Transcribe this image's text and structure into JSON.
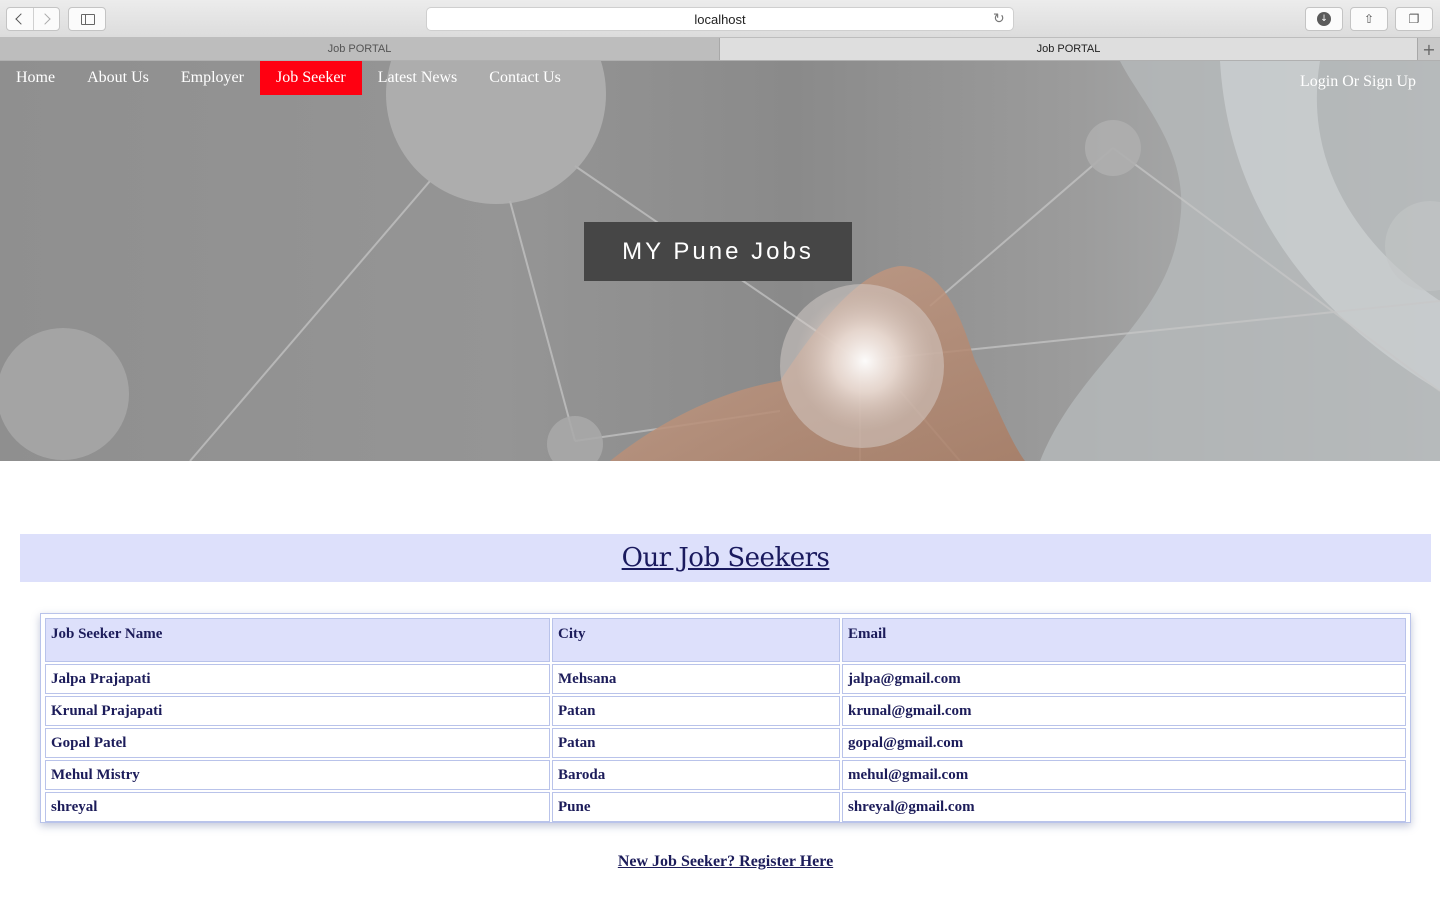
{
  "browser": {
    "address": "localhost",
    "tabs": [
      "Job PORTAL",
      "Job PORTAL"
    ]
  },
  "nav": {
    "items": [
      "Home",
      "About Us",
      "Employer",
      "Job Seeker",
      "Latest News",
      "Contact Us"
    ],
    "active": "Job Seeker",
    "login": "Login Or Sign Up"
  },
  "hero": {
    "title": "MY Pune Jobs"
  },
  "section": {
    "heading": "Our Job Seekers"
  },
  "table": {
    "headers": [
      "Job Seeker Name",
      "City",
      "Email"
    ],
    "rows": [
      [
        "Jalpa Prajapati",
        "Mehsana",
        "jalpa@gmail.com"
      ],
      [
        "Krunal Prajapati",
        "Patan",
        "krunal@gmail.com"
      ],
      [
        "Gopal Patel",
        "Patan",
        "gopal@gmail.com"
      ],
      [
        "Mehul Mistry",
        "Baroda",
        "mehul@gmail.com"
      ],
      [
        "shreyal",
        "Pune",
        "shreyal@gmail.com"
      ]
    ]
  },
  "register_link": "New Job Seeker? Register Here",
  "colors": {
    "active_nav": "#ff0011",
    "heading_bg": "#dde0fb",
    "text_navy": "#1c1c5a"
  }
}
